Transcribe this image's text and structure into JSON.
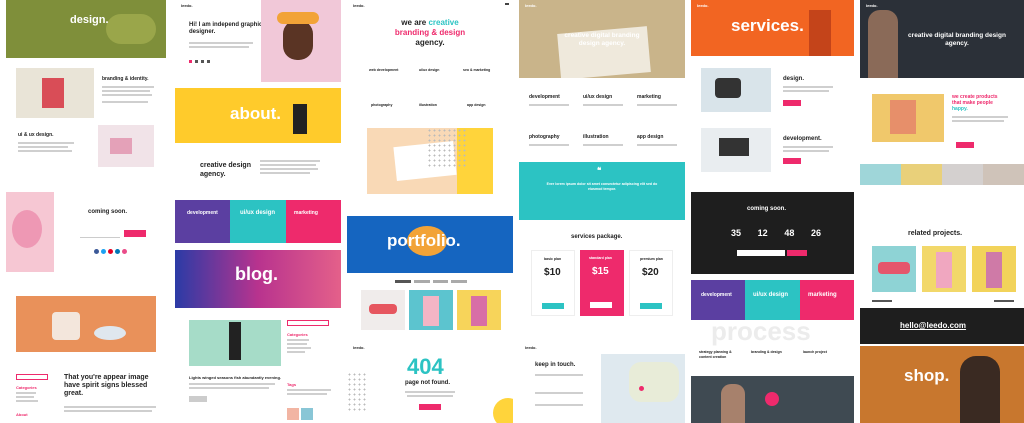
{
  "brand": {
    "logo": "leedo.",
    "accent": "#ee2a6c",
    "yellow": "#ffd43b",
    "teal": "#2cc3c3",
    "purple": "#5b3fa1",
    "blue": "#1565c0"
  },
  "col1": {
    "design_hero": "design.",
    "branding": "branding & identity.",
    "uiux": "ui & ux design.",
    "coming": "coming soon.",
    "post_title": "That you're appear image have spirit signs blessed great.",
    "categories": "Categories",
    "about_head": "About"
  },
  "col2": {
    "intro": "Hi! I am independ graphic designer.",
    "about": "about.",
    "agency": "creative design agency.",
    "tiles": [
      "development",
      "ui/ux design",
      "marketing"
    ],
    "blog": "blog.",
    "caption": "Lights winged seasons fish abundantly evening.",
    "categories": "Categories",
    "tags": "Tags"
  },
  "col3": {
    "headline_1": "we are ",
    "headline_accent": "creative",
    "headline_2": "branding & design",
    "headline_3": "agency.",
    "services": [
      "web development",
      "ui/ux design",
      "seo & marketing",
      "photography",
      "illustration",
      "app design"
    ],
    "portfolio": "portfolio.",
    "e404": "404",
    "not_found": "page not found."
  },
  "col4": {
    "hero": "creative digital branding design agency.",
    "services": [
      "development",
      "ui/ux design",
      "marketing",
      "photography",
      "illustration",
      "app design"
    ],
    "quote": "Ever lorem ipsum dolor sit amet consectetur adipiscing elit sed do eiusmod tempor.",
    "package": "services package.",
    "plans": [
      {
        "name": "basic plan",
        "price": "10"
      },
      {
        "name": "standard plan",
        "price": "15"
      },
      {
        "name": "premium plan",
        "price": "20"
      }
    ],
    "contact": "keep in touch."
  },
  "col5": {
    "services": "services.",
    "design": "design.",
    "development": "development.",
    "coming": "coming soon.",
    "countdown": [
      "35",
      "12",
      "48",
      "26"
    ],
    "tiles": [
      "development",
      "ui/ux design",
      "marketing"
    ],
    "process": "process",
    "steps": [
      "strategy planning & content creation",
      "branding & design",
      "launch project"
    ]
  },
  "col6": {
    "hero": "creative digital branding design agency.",
    "products_1": "we create products",
    "products_2": "that make people",
    "products_3": "happy.",
    "related": "related projects.",
    "email": "hello@leedo.com",
    "shop": "shop."
  }
}
